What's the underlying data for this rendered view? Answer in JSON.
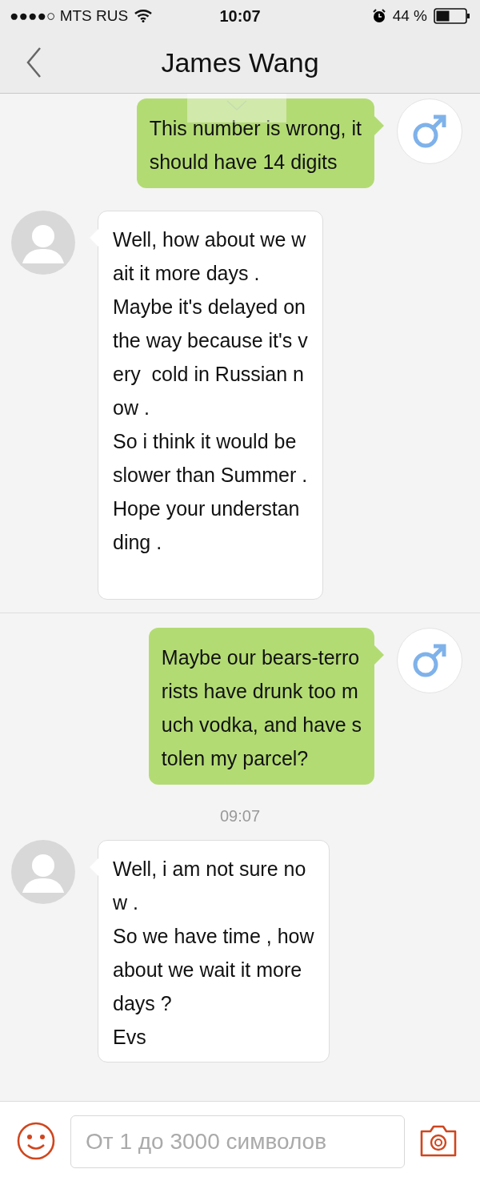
{
  "status_bar": {
    "carrier": "●●●●○ MTS RUS",
    "time": "10:07",
    "battery": "44 %"
  },
  "nav": {
    "title": "James Wang"
  },
  "messages": [
    {
      "kind": "outgoing",
      "lines": [
        "This number is wrong, it",
        "should have 14 digits"
      ]
    },
    {
      "kind": "incoming",
      "lines": [
        "Well, how about we w",
        "ait it more days .",
        "Maybe it's delayed on",
        "the way because it's v",
        "ery  cold in Russian n",
        "ow .",
        "So i think it would be",
        "slower than Summer .",
        "Hope your understan",
        "ding ."
      ]
    },
    {
      "kind": "divider"
    },
    {
      "kind": "outgoing",
      "lines": [
        "Maybe our bears-terro",
        "rists have drunk too m",
        "uch vodka, and have s",
        "tolen my parcel?"
      ]
    },
    {
      "kind": "timestamp",
      "text": "09:07"
    },
    {
      "kind": "incoming",
      "lines": [
        "Well, i am not sure no",
        "w .",
        "So we have time , how",
        "about we wait it more",
        "days ?",
        "Evs"
      ]
    }
  ],
  "composer": {
    "placeholder": "От 1 до 3000 символов"
  }
}
